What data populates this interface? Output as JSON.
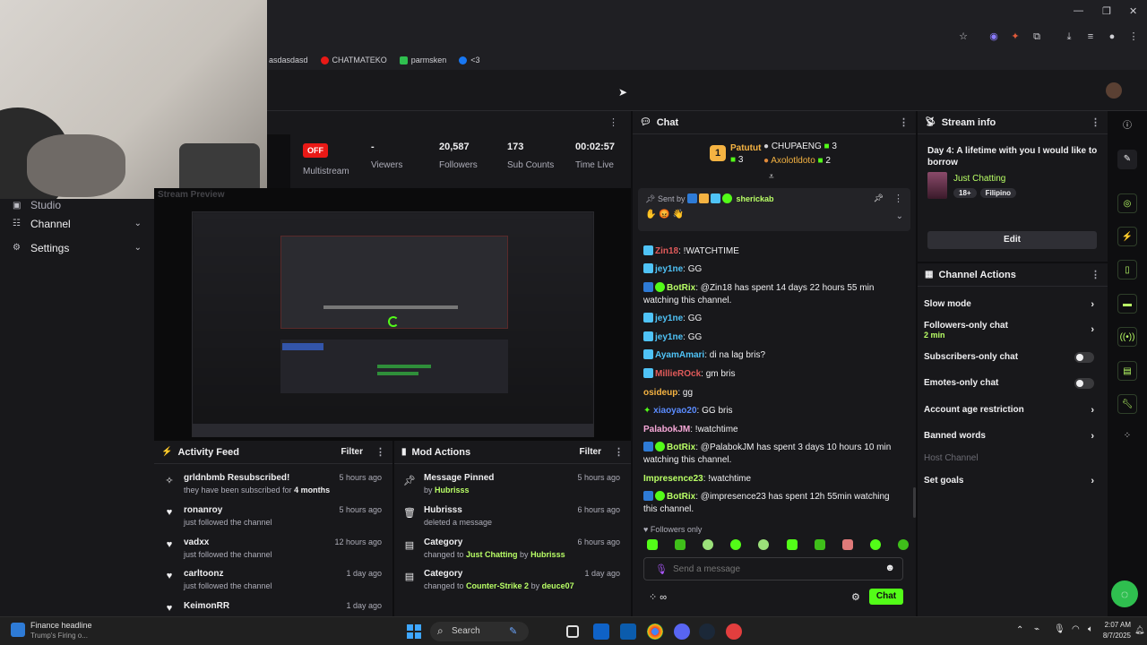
{
  "bookmarks": [
    {
      "label": "asdasdasd",
      "color": "#1f1f23"
    },
    {
      "label": "CHATMATEKO",
      "color": "#e91916"
    },
    {
      "label": "parmsken",
      "color": "#2fbf4f"
    },
    {
      "label": "<3",
      "color": "#1877f2"
    }
  ],
  "leftnav": {
    "items": [
      {
        "label": "Studio",
        "icon": "studio-icon"
      },
      {
        "label": "Channel",
        "icon": "channel-icon"
      },
      {
        "label": "Settings",
        "icon": "gear-icon"
      }
    ]
  },
  "stats": {
    "multistream_badge": "OFF",
    "multistream_label": "Multistream",
    "viewers_value": "-",
    "viewers_label": "Viewers",
    "followers_value": "20,587",
    "followers_label": "Followers",
    "subs_value": "173",
    "subs_label": "Sub Counts",
    "time_value": "00:02:57",
    "time_label": "Time Live"
  },
  "preview": {
    "title": "Stream Preview"
  },
  "activity_feed": {
    "title": "Activity Feed",
    "filter_label": "Filter",
    "items": [
      {
        "icon": "star-icon",
        "title": "grldnbmb Resubscribed!",
        "sub_pre": "they have been subscribed for",
        "sub_bold": "4 months",
        "time": "5 hours ago"
      },
      {
        "icon": "heart-icon",
        "title": "ronanroy",
        "sub_pre": "just followed the channel",
        "sub_bold": "",
        "time": "5 hours ago"
      },
      {
        "icon": "heart-icon",
        "title": "vadxx",
        "sub_pre": "just followed the channel",
        "sub_bold": "",
        "time": "12 hours ago"
      },
      {
        "icon": "heart-icon",
        "title": "carltoonz",
        "sub_pre": "just followed the channel",
        "sub_bold": "",
        "time": "1 day ago"
      },
      {
        "icon": "heart-icon",
        "title": "KeimonRR",
        "sub_pre": "",
        "sub_bold": "",
        "time": "1 day ago"
      }
    ]
  },
  "mod_actions": {
    "title": "Mod Actions",
    "filter_label": "Filter",
    "items": [
      {
        "icon": "pin-icon",
        "title": "Message Pinned",
        "line": [
          "by ",
          "Hubrisss",
          "",
          ""
        ],
        "time": "5 hours ago"
      },
      {
        "icon": "trash-icon",
        "title": "Hubrisss",
        "line": [
          "deleted a message",
          "",
          "",
          ""
        ],
        "time": "6 hours ago"
      },
      {
        "icon": "category-icon",
        "title": "Category",
        "line": [
          "changed to ",
          "Just Chatting",
          " by ",
          "Hubrisss"
        ],
        "time": "6 hours ago"
      },
      {
        "icon": "category-icon",
        "title": "Category",
        "line": [
          "changed to ",
          "Counter-Strike 2",
          " by ",
          "deuce07"
        ],
        "time": "1 day ago"
      }
    ]
  },
  "chat": {
    "title": "Chat",
    "leaders": [
      {
        "name": "Patutut",
        "count": "3"
      },
      {
        "name": "CHUPAENG",
        "count": "3"
      },
      {
        "name": "Axolotldoto",
        "count": "2"
      }
    ],
    "pinned": {
      "sent_by": "Sent by",
      "user": "sherickab"
    },
    "messages": [
      {
        "user": "Zin18",
        "color": "#e05a5a",
        "text": ": !WATCHTIME"
      },
      {
        "user": "jey1ne",
        "color": "#4fc3f7",
        "text": ": GG"
      },
      {
        "user": "BotRix",
        "color": "#b9ff66",
        "text": ": @Zin18 has spent 14 days 22 hours 55 min watching this channel."
      },
      {
        "user": "jey1ne",
        "color": "#4fc3f7",
        "text": ": GG"
      },
      {
        "user": "jey1ne",
        "color": "#4fc3f7",
        "text": ": GG"
      },
      {
        "user": "AyamAmari",
        "color": "#4fc3f7",
        "text": ": di na lag bris?"
      },
      {
        "user": "MillieROck",
        "color": "#e05a5a",
        "text": ": gm bris"
      },
      {
        "user": "osideup",
        "color": "#f5b342",
        "text": ": gg"
      },
      {
        "user": "xiaoyao20",
        "color": "#5b8cff",
        "text": ": GG bris"
      },
      {
        "user": "PalabokJM",
        "color": "#f7a8d8",
        "text": ": !watchtime"
      },
      {
        "user": "BotRix",
        "color": "#b9ff66",
        "text": ": @PalabokJM has spent 3 days 10 hours 10 min watching this channel."
      },
      {
        "user": "Impresence23",
        "color": "#b9ff66",
        "text": ": !watchtime"
      },
      {
        "user": "BotRix",
        "color": "#b9ff66",
        "text": ": @impresence23 has spent 12h 55min watching this channel."
      }
    ],
    "followers_only": "Followers only",
    "input_placeholder": "Send a message",
    "send_label": "Chat"
  },
  "stream_info": {
    "title": "Stream info",
    "stream_title": "Day 4: A lifetime with you I would like to borrow",
    "category": "Just Chatting",
    "tags": [
      "18+",
      "Filipino"
    ],
    "edit_label": "Edit"
  },
  "channel_actions": {
    "title": "Channel Actions",
    "items": [
      {
        "label": "Slow mode",
        "sub": "",
        "control": "chevron"
      },
      {
        "label": "Followers-only chat",
        "sub": "2 min",
        "control": "chevron"
      },
      {
        "label": "Subscribers-only chat",
        "sub": "",
        "control": "toggle"
      },
      {
        "label": "Emotes-only chat",
        "sub": "",
        "control": "toggle"
      },
      {
        "label": "Account age restriction",
        "sub": "",
        "control": "chevron"
      },
      {
        "label": "Banned words",
        "sub": "",
        "control": "chevron"
      },
      {
        "label": "Host Channel",
        "sub": "",
        "control": "disabled"
      },
      {
        "label": "Set goals",
        "sub": "",
        "control": "chevron"
      }
    ]
  },
  "taskbar": {
    "news_title": "Finance headline",
    "news_sub": "Trump's Firing o...",
    "search_label": "Search",
    "time": "2:07 AM",
    "date": "8/7/2025"
  },
  "colors": {
    "accent": "#53fc18",
    "brand_bg": "#18181b",
    "off": "#e91916"
  }
}
